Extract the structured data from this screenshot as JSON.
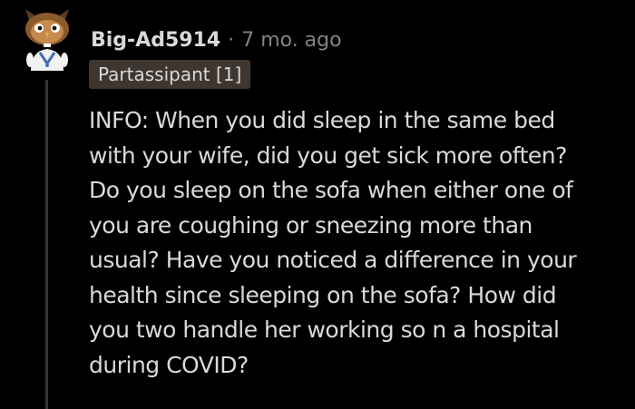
{
  "comment": {
    "username": "Big-Ad5914",
    "separator": "·",
    "timestamp": "7 mo. ago",
    "flair": "Partassipant [1]",
    "body_lines": [
      "INFO: When you did sleep in the same bed",
      "with your wife, did you get sick more often?",
      "Do you sleep on the sofa when either one of",
      "you are coughing or sneezing more than",
      "usual? Have you noticed a difference in your",
      "health since sleeping on the sofa? How did",
      "you two handle her working so n a hospital",
      "during COVID?"
    ]
  },
  "colors": {
    "background": "#000000",
    "text": "#d7dadc",
    "muted": "#818384",
    "flair_bg": "#3f3630",
    "thread_line": "#343536"
  },
  "icons": {
    "avatar": "snoo-avatar-icon"
  }
}
